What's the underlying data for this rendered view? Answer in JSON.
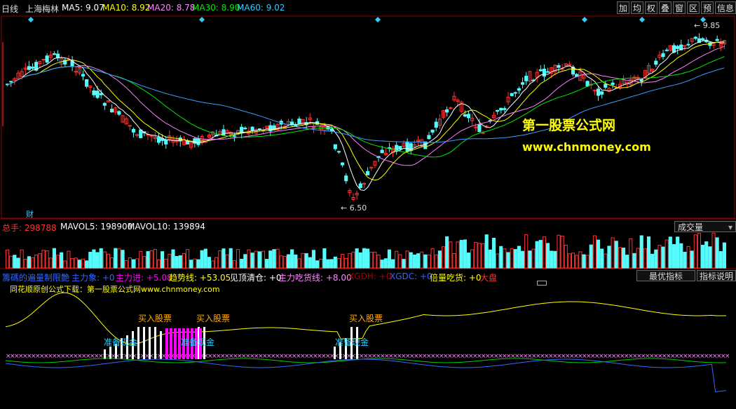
{
  "header": {
    "period": "日线",
    "stock": "上海梅林",
    "ma5": "MA5: 9.07",
    "ma10": "MA10: 8.92",
    "ma20": "MA20: 8.78",
    "ma30": "MA30: 8.90",
    "ma60": "MA60: 9.02",
    "buttons": [
      "加",
      "均",
      "权",
      "叠",
      "窗",
      "区",
      "预",
      "信息"
    ]
  },
  "price_chart": {
    "high_label": "9.85",
    "low_label": "6.50",
    "finance_marker": "财",
    "watermark_title": "第一股票公式网",
    "watermark_url": "www.chnmoney.com"
  },
  "volume_panel": {
    "total": "总手: 298788",
    "mavol5": "MAVOL5: 198900",
    "mavol10": "MAVOL10: 139894",
    "selector": "成交量"
  },
  "indicator_panel": {
    "name": "籌碼的遍量制限艶",
    "main_char": "主力象: +0",
    "main_in": "主力进: +5.08",
    "trend": "趋势线: +53.05",
    "top_clear": "见顶清仓: +0",
    "main_eat": "主力吃货线: +8.00",
    "xgdh": "XGDH: +0",
    "xgdc": "XGDC: +0",
    "double_eat": "倍量吃货: +0",
    "market": "大盘",
    "best_button": "最优指标",
    "help_button": "指标说明",
    "source_line": "同花顺原创公式下载：第一股票公式网www.chnmoney.com",
    "annotations": {
      "buy1": "买入股票",
      "buy2": "买入股票",
      "buy3": "买入股票",
      "prep1": "准备现金",
      "prep2": "准备现金",
      "prep3": "准备现金"
    }
  },
  "colors": {
    "up": "#ff3232",
    "down": "#54fcfc",
    "ma5": "#ffffff",
    "ma10": "#ffff00",
    "ma20": "#ff80ff",
    "ma30": "#00e600",
    "ma60": "#3c9cff",
    "grid": "#8b0000"
  }
}
